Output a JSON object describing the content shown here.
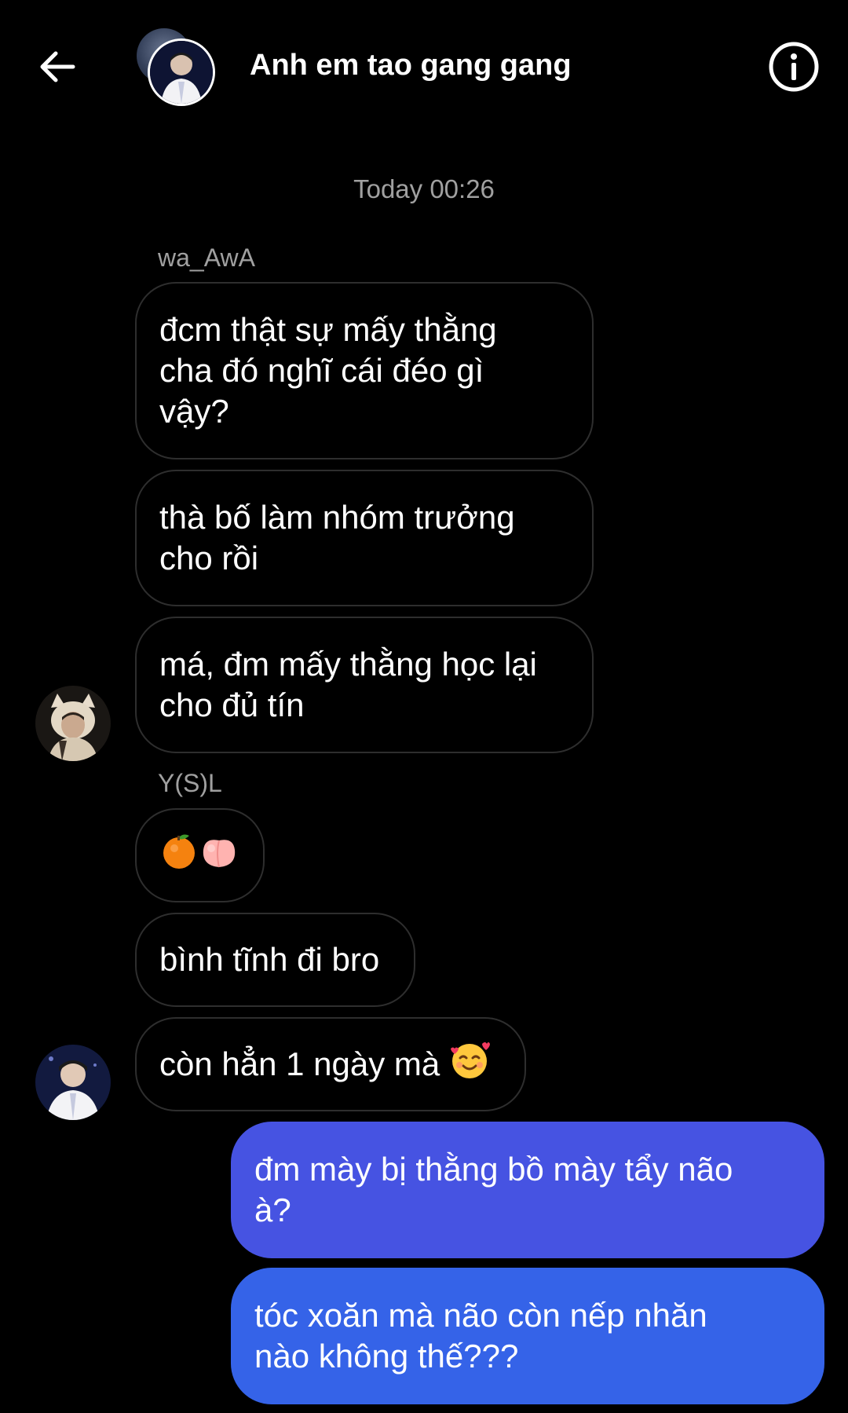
{
  "header": {
    "title": "Anh em tao gang gang",
    "back_icon": "arrow-left-icon",
    "info_icon": "info-icon"
  },
  "timestamp": "Today 00:26",
  "messages": {
    "sender1": "wa_AwA",
    "m1": "đcm thật sự mấy thằng\ncha đó nghĩ cái đéo gì\nvậy?",
    "m2": "thà bố làm nhóm trưởng\ncho rồi",
    "m3": "má, đm mấy thằng học lại\ncho đủ tín",
    "sender2": "Y(S)L",
    "m4_emoji": [
      "tangerine-emoji",
      "peach-emoji"
    ],
    "m5": "bình tĩnh đi bro",
    "m6": "còn hẳn 1 ngày mà",
    "m6_emoji": "smiling-face-with-hearts-emoji",
    "m7": "đm mày bị thằng bồ mày tẩy não\nà?",
    "m8": "tóc xoăn mà não còn nếp nhăn\nnào không thế???"
  },
  "colors": {
    "background": "#000000",
    "incoming_border": "#2e2e2e",
    "outgoing_top": "#4950e0",
    "outgoing_bottom": "#3362e8",
    "meta_text": "#a0a0a0"
  }
}
